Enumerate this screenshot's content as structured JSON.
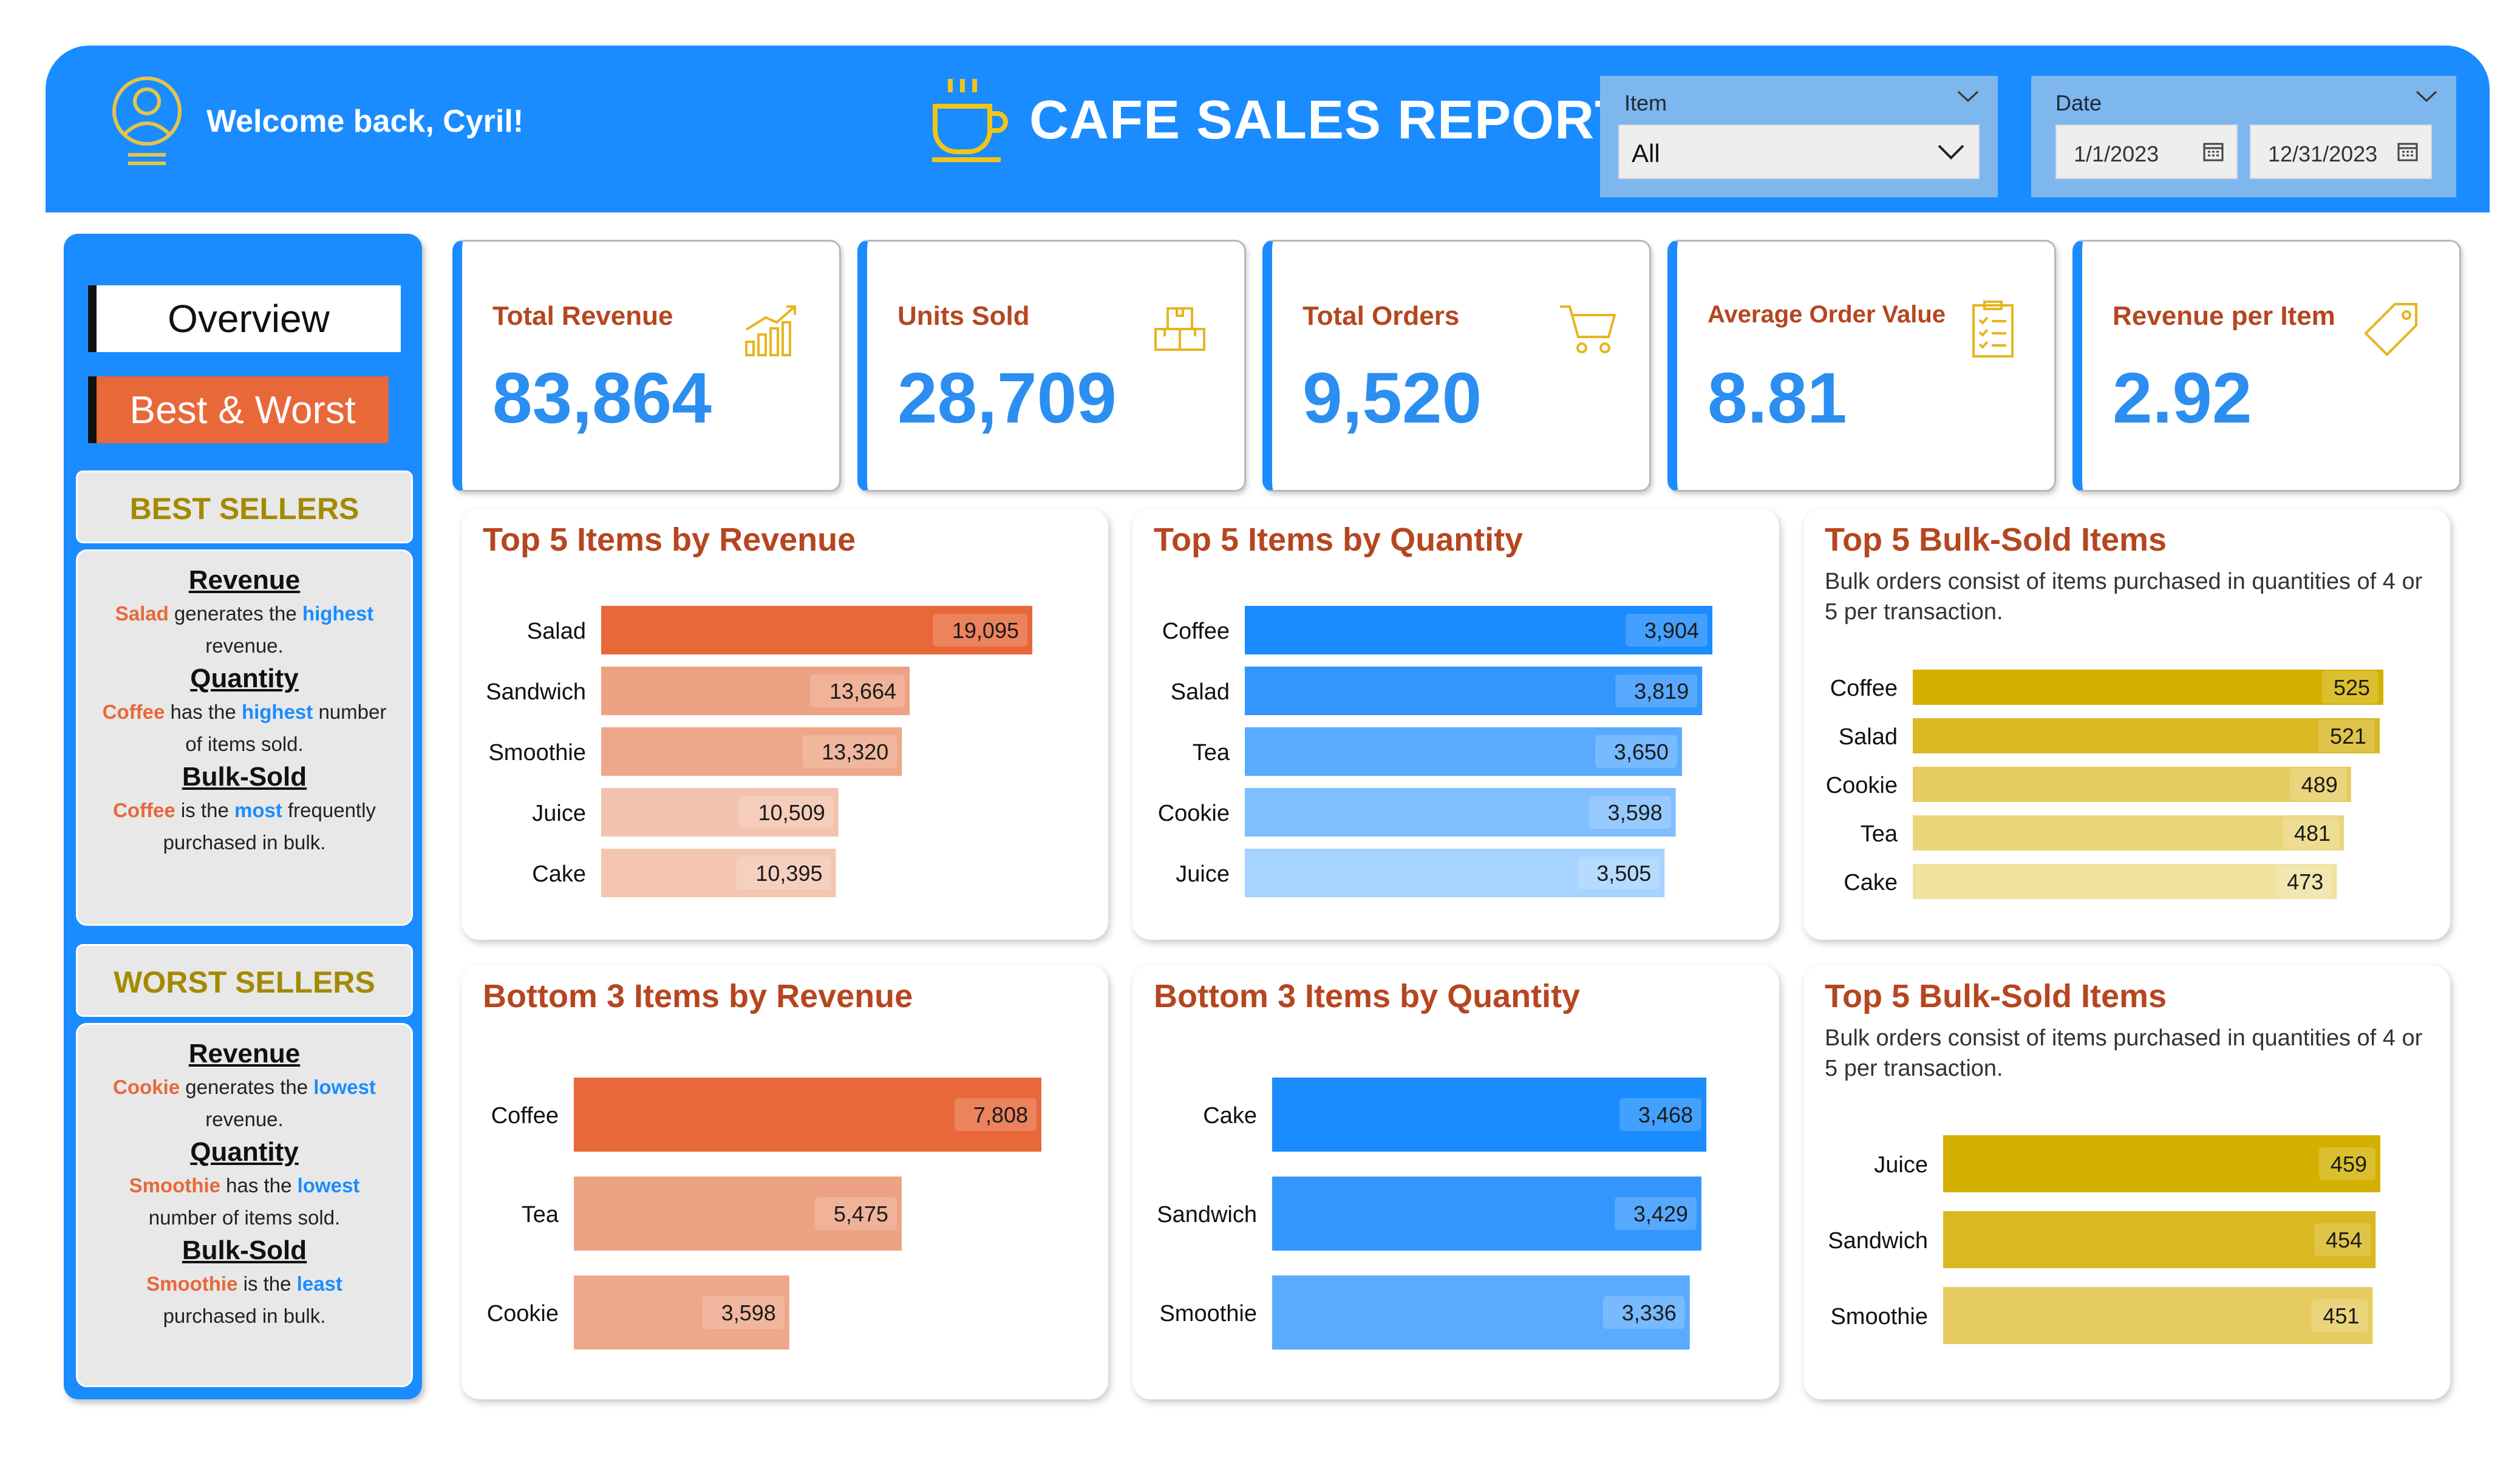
{
  "header": {
    "welcome": "Welcome back, Cyril!",
    "title": "CAFE SALES REPORT",
    "item_slicer": {
      "label": "Item",
      "value": "All"
    },
    "date_slicer": {
      "label": "Date",
      "start": "1/1/2023",
      "end": "12/31/2023"
    }
  },
  "sidebar": {
    "nav": {
      "overview": "Overview",
      "best_worst": "Best & Worst"
    },
    "best": {
      "heading": "BEST SELLERS",
      "revenue": {
        "title": "Revenue",
        "item": "Salad",
        "pre": " generates the ",
        "kw": "highest",
        "post": "revenue."
      },
      "quantity": {
        "title": "Quantity",
        "item": "Coffee",
        "pre": " has the ",
        "kw": "highest",
        "post": " number",
        "post2": "of items sold."
      },
      "bulk": {
        "title": "Bulk-Sold",
        "item": "Coffee",
        "pre": " is the ",
        "kw": "most",
        "post": " frequently",
        "post2": "purchased in bulk."
      }
    },
    "worst": {
      "heading": "WORST SELLERS",
      "revenue": {
        "title": "Revenue",
        "item": "Cookie",
        "pre": " generates the ",
        "kw": "lowest",
        "post": "revenue."
      },
      "quantity": {
        "title": "Quantity",
        "item": "Smoothie",
        "pre": " has the ",
        "kw": "lowest",
        "post": "number of items sold."
      },
      "bulk": {
        "title": "Bulk-Sold",
        "item": "Smoothie",
        "pre": " is the ",
        "kw": "least",
        "post": "purchased in bulk."
      }
    }
  },
  "kpis": [
    {
      "label": "Total Revenue",
      "value": "83,864",
      "icon": "bar-chart-icon"
    },
    {
      "label": "Units Sold",
      "value": "28,709",
      "icon": "boxes-icon"
    },
    {
      "label": "Total Orders",
      "value": "9,520",
      "icon": "cart-icon"
    },
    {
      "label": "Average Order Value",
      "value": "8.81",
      "icon": "clipboard-icon"
    },
    {
      "label": "Revenue per Item",
      "value": "2.92",
      "icon": "tag-icon"
    }
  ],
  "colors": {
    "primary": "#1a8cff",
    "orange": [
      "#e8683a",
      "#eda383",
      "#eea889",
      "#f3c3ad",
      "#f4c6b1"
    ],
    "blue": [
      "#1a8cff",
      "#3396ff",
      "#5aabff",
      "#7fbfff",
      "#a6d3ff"
    ],
    "gold": [
      "#d4b100",
      "#d9b822",
      "#e6cc60",
      "#ebd57a",
      "#f0e29f"
    ]
  },
  "chart_data": [
    {
      "type": "bar",
      "title": "Top 5 Items by Revenue",
      "subtitle": "",
      "categories": [
        "Salad",
        "Sandwich",
        "Smoothie",
        "Juice",
        "Cake"
      ],
      "values": [
        19095,
        13664,
        13320,
        10509,
        10395
      ],
      "labels": [
        "19,095",
        "13,664",
        "13,320",
        "10,509",
        "10,395"
      ],
      "palette": "orange",
      "xmax": 19095
    },
    {
      "type": "bar",
      "title": "Top 5 Items by Quantity",
      "subtitle": "",
      "categories": [
        "Coffee",
        "Salad",
        "Tea",
        "Cookie",
        "Juice"
      ],
      "values": [
        3904,
        3819,
        3650,
        3598,
        3505
      ],
      "labels": [
        "3,904",
        "3,819",
        "3,650",
        "3,598",
        "3,505"
      ],
      "palette": "blue",
      "xmax": 3904
    },
    {
      "type": "bar",
      "title": "Top 5 Bulk-Sold Items",
      "subtitle": "Bulk orders consist of items purchased in quantities of 4 or 5 per transaction.",
      "categories": [
        "Coffee",
        "Salad",
        "Cookie",
        "Tea",
        "Cake"
      ],
      "values": [
        525,
        521,
        489,
        481,
        473
      ],
      "labels": [
        "525",
        "521",
        "489",
        "481",
        "473"
      ],
      "palette": "gold",
      "xmax": 525
    },
    {
      "type": "bar",
      "title": "Bottom 3 Items by Revenue",
      "subtitle": "",
      "categories": [
        "Coffee",
        "Tea",
        "Cookie"
      ],
      "values": [
        7808,
        5475,
        3598
      ],
      "labels": [
        "7,808",
        "5,475",
        "3,598"
      ],
      "palette": "orange",
      "xmax": 7808
    },
    {
      "type": "bar",
      "title": "Bottom 3 Items by Quantity",
      "subtitle": "",
      "categories": [
        "Cake",
        "Sandwich",
        "Smoothie"
      ],
      "values": [
        3468,
        3429,
        3336
      ],
      "labels": [
        "3,468",
        "3,429",
        "3,336"
      ],
      "palette": "blue",
      "xmax": 3468
    },
    {
      "type": "bar",
      "title": "Top 5 Bulk-Sold Items",
      "subtitle": "Bulk orders consist of items purchased in quantities of 4 or 5 per transaction.",
      "categories": [
        "Juice",
        "Sandwich",
        "Smoothie"
      ],
      "values": [
        459,
        454,
        451
      ],
      "labels": [
        "459",
        "454",
        "451"
      ],
      "palette": "gold",
      "xmax": 459
    }
  ]
}
